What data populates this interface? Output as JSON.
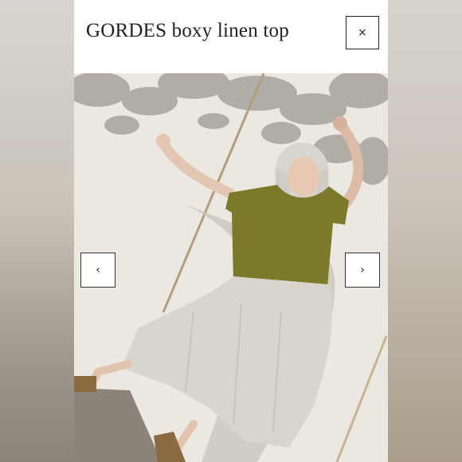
{
  "modal": {
    "title": "GORDES boxy linen top",
    "close_icon": "close-icon",
    "close_glyph": "×"
  },
  "gallery": {
    "prev_icon": "chevron-left-icon",
    "next_icon": "chevron-right-icon",
    "prev_glyph": "‹",
    "next_glyph": "›"
  },
  "colors": {
    "top_olive": "#7a7a2a",
    "skirt_linen": "#d9d5cc",
    "wall": "#ece9e4"
  }
}
